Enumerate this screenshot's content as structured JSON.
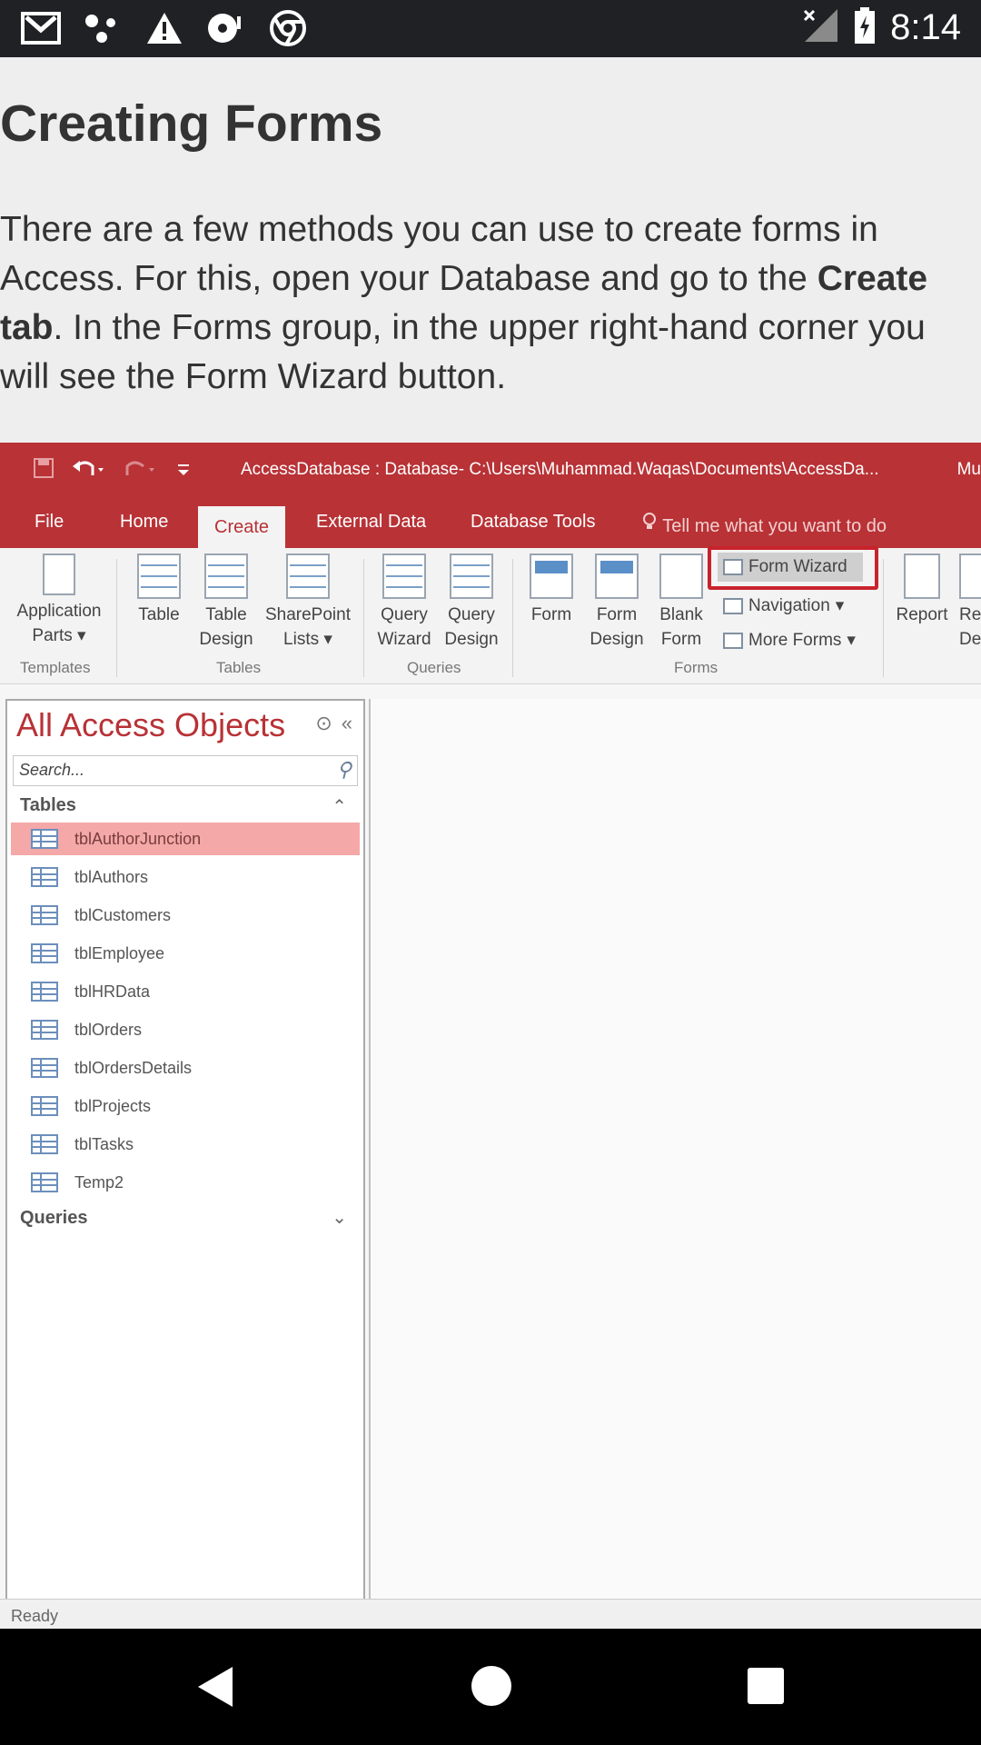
{
  "status_bar": {
    "time": "8:14",
    "left_icons": [
      "gmail-icon",
      "dots-icon",
      "warning-icon",
      "music-icon",
      "chrome-icon"
    ]
  },
  "article": {
    "title": "Creating Forms",
    "paragraph": {
      "line1": "There are a few methods you can use to create forms in",
      "line2_a": "Access. For this, open your Database and go to the ",
      "line2_b": "Create",
      "line3_a": "tab",
      "line3_b": ". In the Forms group, in the upper right-hand corner you",
      "line4": "will see the Form Wizard button."
    }
  },
  "access": {
    "window_title": "AccessDatabase : Database- C:\\Users\\Muhammad.Waqas\\Documents\\AccessDa...",
    "window_title_right": "Mu",
    "tabs": [
      "File",
      "Home",
      "Create",
      "External Data",
      "Database Tools"
    ],
    "active_tab": "Create",
    "tell_me": "Tell me what you want to do",
    "ribbon": {
      "app_parts": [
        "Application",
        "Parts"
      ],
      "table": "Table",
      "table_design": [
        "Table",
        "Design"
      ],
      "sharepoint": [
        "SharePoint",
        "Lists"
      ],
      "query_wizard": [
        "Query",
        "Wizard"
      ],
      "query_design": [
        "Query",
        "Design"
      ],
      "form": "Form",
      "form_design": [
        "Form",
        "Design"
      ],
      "blank_form": [
        "Blank",
        "Form"
      ],
      "form_wizard": "Form Wizard",
      "navigation": "Navigation",
      "more_forms": "More Forms",
      "report": "Report",
      "report_design_partial": [
        "Re",
        "De"
      ],
      "groups": {
        "templates": "Templates",
        "tables": "Tables",
        "queries": "Queries",
        "forms": "Forms"
      }
    },
    "nav_pane": {
      "header": "All Access Objects",
      "search_placeholder": "Search...",
      "tables_label": "Tables",
      "queries_label": "Queries",
      "tables": [
        "tblAuthorJunction",
        "tblAuthors",
        "tblCustomers",
        "tblEmployee",
        "tblHRData",
        "tblOrders",
        "tblOrdersDetails",
        "tblProjects",
        "tblTasks",
        "Temp2"
      ],
      "selected_index": 0
    },
    "status": "Ready"
  }
}
